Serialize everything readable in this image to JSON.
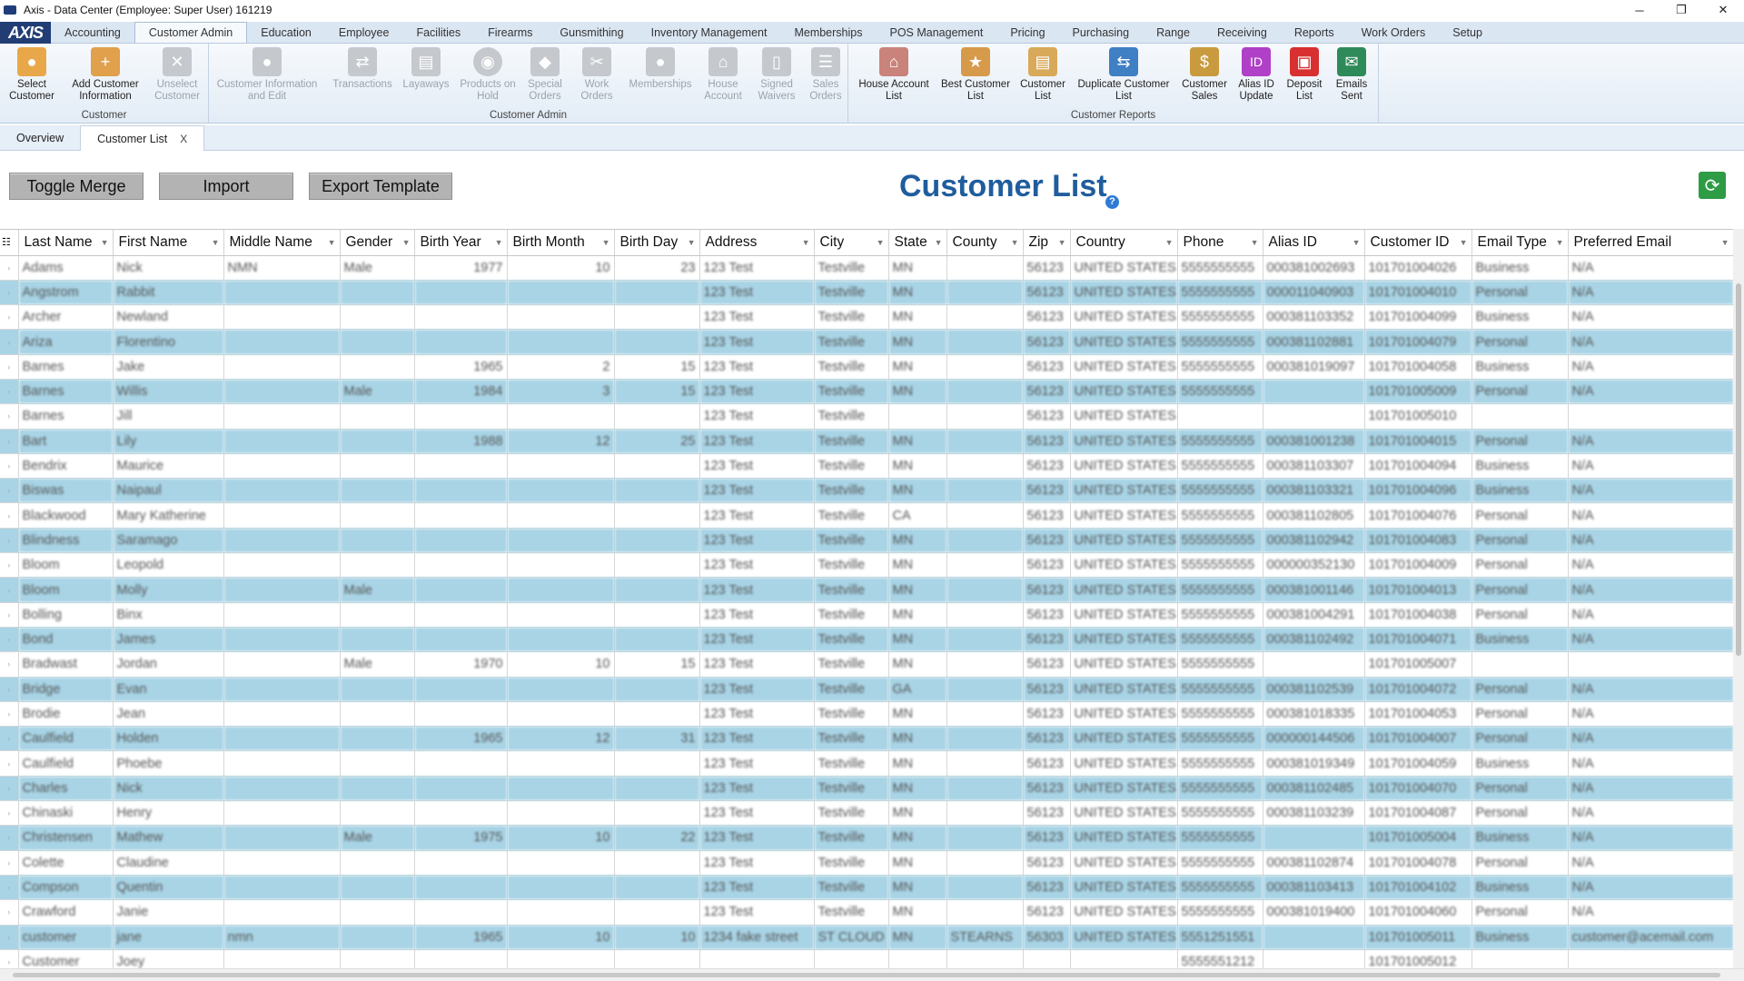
{
  "window": {
    "title": "Axis - Data Center  (Employee: Super User) 161219",
    "minimize": "─",
    "restore": "❐",
    "close": "✕"
  },
  "logo": "AXIS",
  "menu": [
    "Accounting",
    "Customer Admin",
    "Education",
    "Employee",
    "Facilities",
    "Firearms",
    "Gunsmithing",
    "Inventory Management",
    "Memberships",
    "POS Management",
    "Pricing",
    "Purchasing",
    "Range",
    "Receiving",
    "Reports",
    "Work Orders",
    "Setup"
  ],
  "ribbon": {
    "customer_group": "Customer",
    "customer_admin_group": "Customer Admin",
    "customer_reports_group": "Customer Reports",
    "select_customer": "Select Customer",
    "add_customer": "Add Customer Information",
    "unselect_customer": "Unselect Customer",
    "customer_info_edit": "Customer Information and Edit",
    "transactions": "Transactions",
    "layaways": "Layaways",
    "products_on_hold": "Products on Hold",
    "special_orders": "Special Orders",
    "work_orders": "Work Orders",
    "memberships": "Memberships",
    "house_account": "House Account",
    "signed_waivers": "Signed Waivers",
    "sales_orders": "Sales Orders",
    "house_account_list": "House Account List",
    "best_customer_list": "Best Customer List",
    "customer_list": "Customer List",
    "duplicate_customer_list": "Duplicate Customer List",
    "customer_sales": "Customer Sales",
    "alias_id_update": "Alias ID Update",
    "deposit_list": "Deposit List",
    "emails_sent": "Emails Sent"
  },
  "tabs": {
    "overview": "Overview",
    "customer_list": "Customer List",
    "close": "X"
  },
  "toolbar": {
    "toggle_merge": "Toggle Merge",
    "import": "Import",
    "export_template": "Export Template",
    "page_title": "Customer List",
    "help": "?",
    "refresh": "⟳"
  },
  "columns": [
    "Last Name",
    "First Name",
    "Middle Name",
    "Gender",
    "Birth Year",
    "Birth Month",
    "Birth Day",
    "Address",
    "City",
    "State",
    "County",
    "Zip",
    "Country",
    "Phone",
    "Alias ID",
    "Customer ID",
    "Email Type",
    "Preferred Email"
  ],
  "rows": [
    [
      "Adams",
      "Nick",
      "NMN",
      "Male",
      "1977",
      "10",
      "23",
      "123 Test",
      "Testville",
      "MN",
      "",
      "56123",
      "UNITED STATES",
      "5555555555",
      "000381002693",
      "101701004026",
      "Business",
      "N/A"
    ],
    [
      "Angstrom",
      "Rabbit",
      "",
      "",
      "",
      "",
      "",
      "123 Test",
      "Testville",
      "MN",
      "",
      "56123",
      "UNITED STATES",
      "5555555555",
      "000011040903",
      "101701004010",
      "Personal",
      "N/A"
    ],
    [
      "Archer",
      "Newland",
      "",
      "",
      "",
      "",
      "",
      "123 Test",
      "Testville",
      "MN",
      "",
      "56123",
      "UNITED STATES",
      "5555555555",
      "000381103352",
      "101701004099",
      "Business",
      "N/A"
    ],
    [
      "Ariza",
      "Florentino",
      "",
      "",
      "",
      "",
      "",
      "123 Test",
      "Testville",
      "MN",
      "",
      "56123",
      "UNITED STATES",
      "5555555555",
      "000381102881",
      "101701004079",
      "Personal",
      "N/A"
    ],
    [
      "Barnes",
      "Jake",
      "",
      "",
      "1965",
      "2",
      "15",
      "123 Test",
      "Testville",
      "MN",
      "",
      "56123",
      "UNITED STATES",
      "5555555555",
      "000381019097",
      "101701004058",
      "Business",
      "N/A"
    ],
    [
      "Barnes",
      "Willis",
      "",
      "Male",
      "1984",
      "3",
      "15",
      "123 Test",
      "Testville",
      "MN",
      "",
      "56123",
      "UNITED STATES",
      "5555555555",
      "",
      "101701005009",
      "Personal",
      "N/A"
    ],
    [
      "Barnes",
      "Jill",
      "",
      "",
      "",
      "",
      "",
      "123 Test",
      "Testville",
      "",
      "",
      "56123",
      "UNITED STATES",
      "",
      "",
      "101701005010",
      "",
      ""
    ],
    [
      "Bart",
      "Lily",
      "",
      "",
      "1988",
      "12",
      "25",
      "123 Test",
      "Testville",
      "MN",
      "",
      "56123",
      "UNITED STATES",
      "5555555555",
      "000381001238",
      "101701004015",
      "Personal",
      "N/A"
    ],
    [
      "Bendrix",
      "Maurice",
      "",
      "",
      "",
      "",
      "",
      "123 Test",
      "Testville",
      "MN",
      "",
      "56123",
      "UNITED STATES",
      "5555555555",
      "000381103307",
      "101701004094",
      "Business",
      "N/A"
    ],
    [
      "Biswas",
      "Naipaul",
      "",
      "",
      "",
      "",
      "",
      "123 Test",
      "Testville",
      "MN",
      "",
      "56123",
      "UNITED STATES",
      "5555555555",
      "000381103321",
      "101701004096",
      "Business",
      "N/A"
    ],
    [
      "Blackwood",
      "Mary Katherine",
      "",
      "",
      "",
      "",
      "",
      "123 Test",
      "Testville",
      "CA",
      "",
      "56123",
      "UNITED STATES",
      "5555555555",
      "000381102805",
      "101701004076",
      "Personal",
      "N/A"
    ],
    [
      "Blindness",
      "Saramago",
      "",
      "",
      "",
      "",
      "",
      "123 Test",
      "Testville",
      "MN",
      "",
      "56123",
      "UNITED STATES",
      "5555555555",
      "000381102942",
      "101701004083",
      "Personal",
      "N/A"
    ],
    [
      "Bloom",
      "Leopold",
      "",
      "",
      "",
      "",
      "",
      "123 Test",
      "Testville",
      "MN",
      "",
      "56123",
      "UNITED STATES",
      "5555555555",
      "000000352130",
      "101701004009",
      "Personal",
      "N/A"
    ],
    [
      "Bloom",
      "Molly",
      "",
      "Male",
      "",
      "",
      "",
      "123 Test",
      "Testville",
      "MN",
      "",
      "56123",
      "UNITED STATES",
      "5555555555",
      "000381001146",
      "101701004013",
      "Personal",
      "N/A"
    ],
    [
      "Bolling",
      "Binx",
      "",
      "",
      "",
      "",
      "",
      "123 Test",
      "Testville",
      "MN",
      "",
      "56123",
      "UNITED STATES",
      "5555555555",
      "000381004291",
      "101701004038",
      "Personal",
      "N/A"
    ],
    [
      "Bond",
      "James",
      "",
      "",
      "",
      "",
      "",
      "123 Test",
      "Testville",
      "MN",
      "",
      "56123",
      "UNITED STATES",
      "5555555555",
      "000381102492",
      "101701004071",
      "Business",
      "N/A"
    ],
    [
      "Bradwast",
      "Jordan",
      "",
      "Male",
      "1970",
      "10",
      "15",
      "123 Test",
      "Testville",
      "MN",
      "",
      "56123",
      "UNITED STATES",
      "5555555555",
      "",
      "101701005007",
      "",
      ""
    ],
    [
      "Bridge",
      "Evan",
      "",
      "",
      "",
      "",
      "",
      "123 Test",
      "Testville",
      "GA",
      "",
      "56123",
      "UNITED STATES",
      "5555555555",
      "000381102539",
      "101701004072",
      "Personal",
      "N/A"
    ],
    [
      "Brodie",
      "Jean",
      "",
      "",
      "",
      "",
      "",
      "123 Test",
      "Testville",
      "MN",
      "",
      "56123",
      "UNITED STATES",
      "5555555555",
      "000381018335",
      "101701004053",
      "Personal",
      "N/A"
    ],
    [
      "Caulfield",
      "Holden",
      "",
      "",
      "1965",
      "12",
      "31",
      "123 Test",
      "Testville",
      "MN",
      "",
      "56123",
      "UNITED STATES",
      "5555555555",
      "000000144506",
      "101701004007",
      "Personal",
      "N/A"
    ],
    [
      "Caulfield",
      "Phoebe",
      "",
      "",
      "",
      "",
      "",
      "123 Test",
      "Testville",
      "MN",
      "",
      "56123",
      "UNITED STATES",
      "5555555555",
      "000381019349",
      "101701004059",
      "Business",
      "N/A"
    ],
    [
      "Charles",
      "Nick",
      "",
      "",
      "",
      "",
      "",
      "123 Test",
      "Testville",
      "MN",
      "",
      "56123",
      "UNITED STATES",
      "5555555555",
      "000381102485",
      "101701004070",
      "Personal",
      "N/A"
    ],
    [
      "Chinaski",
      "Henry",
      "",
      "",
      "",
      "",
      "",
      "123 Test",
      "Testville",
      "MN",
      "",
      "56123",
      "UNITED STATES",
      "5555555555",
      "000381103239",
      "101701004087",
      "Personal",
      "N/A"
    ],
    [
      "Christensen",
      "Mathew",
      "",
      "Male",
      "1975",
      "10",
      "22",
      "123 Test",
      "Testville",
      "MN",
      "",
      "56123",
      "UNITED STATES",
      "5555555555",
      "",
      "101701005004",
      "Business",
      "N/A"
    ],
    [
      "Colette",
      "Claudine",
      "",
      "",
      "",
      "",
      "",
      "123 Test",
      "Testville",
      "MN",
      "",
      "56123",
      "UNITED STATES",
      "5555555555",
      "000381102874",
      "101701004078",
      "Personal",
      "N/A"
    ],
    [
      "Compson",
      "Quentin",
      "",
      "",
      "",
      "",
      "",
      "123 Test",
      "Testville",
      "MN",
      "",
      "56123",
      "UNITED STATES",
      "5555555555",
      "000381103413",
      "101701004102",
      "Business",
      "N/A"
    ],
    [
      "Crawford",
      "Janie",
      "",
      "",
      "",
      "",
      "",
      "123 Test",
      "Testville",
      "MN",
      "",
      "56123",
      "UNITED STATES",
      "5555555555",
      "000381019400",
      "101701004060",
      "Personal",
      "N/A"
    ],
    [
      "customer",
      "jane",
      "nmn",
      "",
      "1965",
      "10",
      "10",
      "1234 fake street",
      "ST CLOUD",
      "MN",
      "STEARNS",
      "56303",
      "UNITED STATES",
      "5551251551",
      "",
      "101701005011",
      "Business",
      "customer@acemail.com"
    ],
    [
      "Customer",
      "Joey",
      "",
      "",
      "",
      "",
      "",
      "",
      "",
      "",
      "",
      "",
      "",
      "5555551212",
      "",
      "101701005012",
      "",
      ""
    ]
  ]
}
